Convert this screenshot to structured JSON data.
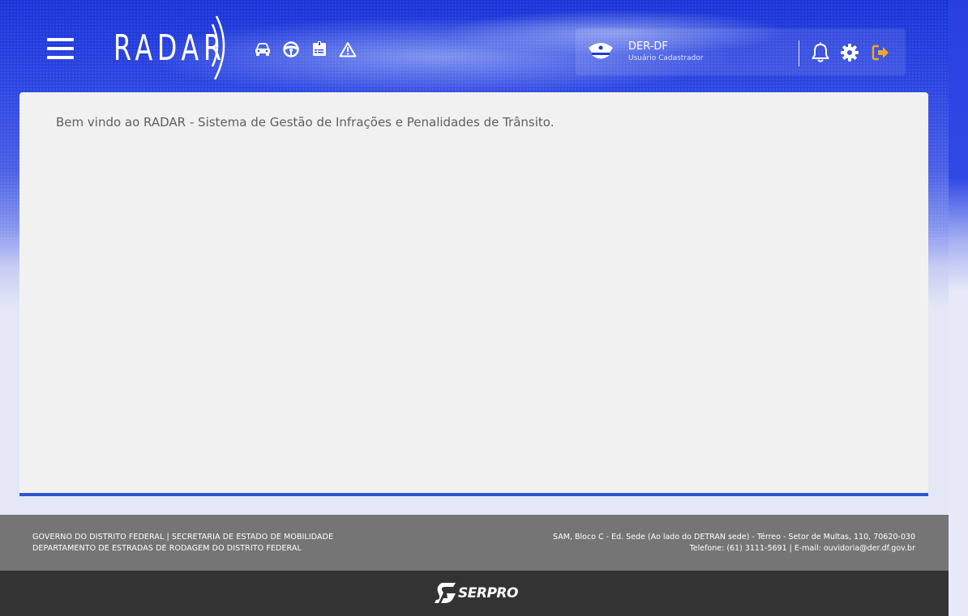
{
  "header": {
    "logo_text": "RADAR",
    "nav_icons": [
      "car-icon",
      "steering-wheel-icon",
      "document-list-icon",
      "warning-icon"
    ]
  },
  "user": {
    "name": "DER-DF",
    "role": "Usuário Cadastrador",
    "avatar_icon": "police-cap-icon",
    "actions": [
      "bell-icon",
      "gear-icon",
      "logout-icon"
    ],
    "logout_color": "#f5a623"
  },
  "main": {
    "welcome_text": "Bem vindo ao RADAR - Sistema de Gestão de Infrações e Penalidades de Trânsito."
  },
  "footer": {
    "left_line1": "GOVERNO DO DISTRITO FEDERAL | SECRETARIA DE ESTADO DE MOBILIDADE",
    "left_line2": "DEPARTAMENTO DE ESTRADAS DE RODAGEM DO DISTRITO FEDERAL",
    "right_line1": "SAM, Bloco C - Ed. Sede (Ao lado do DETRAN sede) - Térreo - Setor de Multas, 110, 70620-030",
    "right_line2": "Telefone: (61) 3111-5691 | E-mail: ouvidoria@der.df.gov.br",
    "brand": "SERPRO"
  },
  "colors": {
    "header_blue": "#1a34d8",
    "card_bg": "#f1f1f1",
    "card_accent": "#2f55d4",
    "footer_gray": "#757575",
    "footer_dark": "#333333"
  }
}
